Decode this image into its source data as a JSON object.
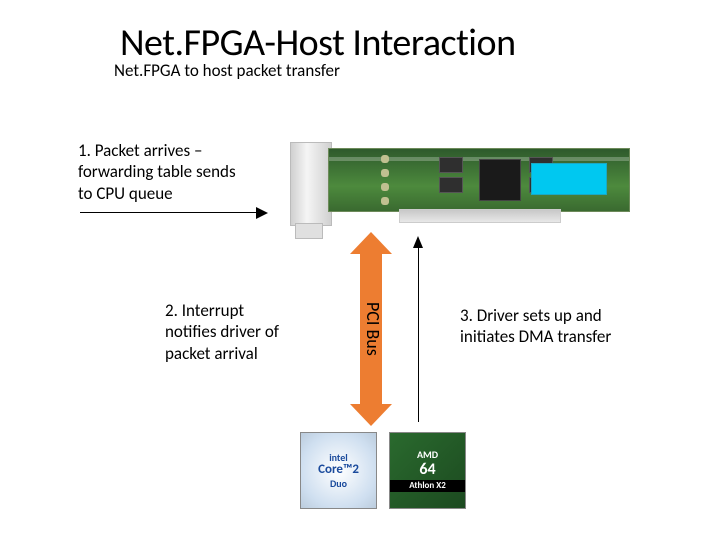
{
  "title": "Net.FPGA-Host Interaction",
  "subtitle": "Net.FPGA to host packet transfer",
  "steps": {
    "s1": "1. Packet arrives – forwarding table sends to CPU queue",
    "s2": "2. Interrupt notifies driver of packet arrival",
    "s3": "3. Driver sets up and initiates DMA transfer"
  },
  "bus_label": "PCI Bus",
  "logos": {
    "intel_line1": "intel",
    "intel_line2": "Core™2",
    "intel_line3": "Duo",
    "amd_line1": "AMD",
    "amd_line2": "64",
    "amd_line3": "Athlon X2"
  }
}
